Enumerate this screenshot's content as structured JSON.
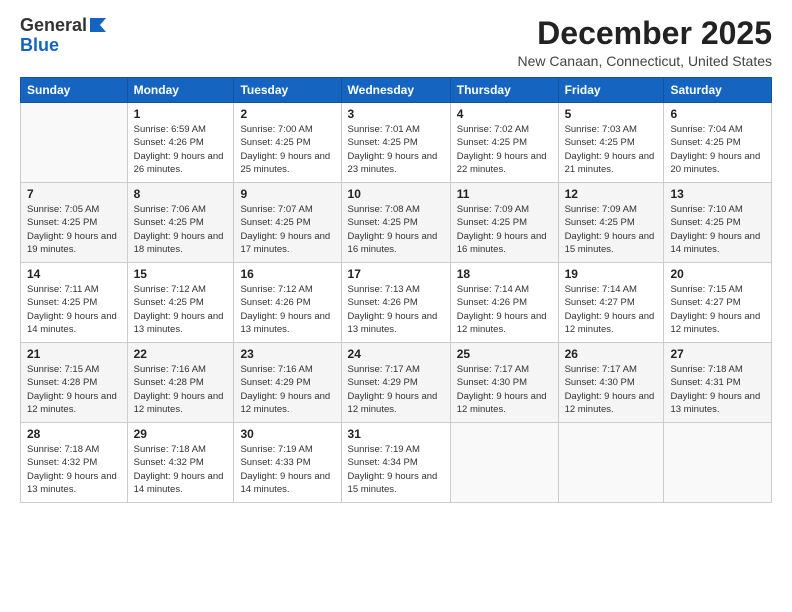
{
  "logo": {
    "general": "General",
    "blue": "Blue"
  },
  "header": {
    "month": "December 2025",
    "location": "New Canaan, Connecticut, United States"
  },
  "days_of_week": [
    "Sunday",
    "Monday",
    "Tuesday",
    "Wednesday",
    "Thursday",
    "Friday",
    "Saturday"
  ],
  "weeks": [
    [
      {
        "day": "",
        "sunrise": "",
        "sunset": "",
        "daylight": ""
      },
      {
        "day": "1",
        "sunrise": "Sunrise: 6:59 AM",
        "sunset": "Sunset: 4:26 PM",
        "daylight": "Daylight: 9 hours and 26 minutes."
      },
      {
        "day": "2",
        "sunrise": "Sunrise: 7:00 AM",
        "sunset": "Sunset: 4:25 PM",
        "daylight": "Daylight: 9 hours and 25 minutes."
      },
      {
        "day": "3",
        "sunrise": "Sunrise: 7:01 AM",
        "sunset": "Sunset: 4:25 PM",
        "daylight": "Daylight: 9 hours and 23 minutes."
      },
      {
        "day": "4",
        "sunrise": "Sunrise: 7:02 AM",
        "sunset": "Sunset: 4:25 PM",
        "daylight": "Daylight: 9 hours and 22 minutes."
      },
      {
        "day": "5",
        "sunrise": "Sunrise: 7:03 AM",
        "sunset": "Sunset: 4:25 PM",
        "daylight": "Daylight: 9 hours and 21 minutes."
      },
      {
        "day": "6",
        "sunrise": "Sunrise: 7:04 AM",
        "sunset": "Sunset: 4:25 PM",
        "daylight": "Daylight: 9 hours and 20 minutes."
      }
    ],
    [
      {
        "day": "7",
        "sunrise": "Sunrise: 7:05 AM",
        "sunset": "Sunset: 4:25 PM",
        "daylight": "Daylight: 9 hours and 19 minutes."
      },
      {
        "day": "8",
        "sunrise": "Sunrise: 7:06 AM",
        "sunset": "Sunset: 4:25 PM",
        "daylight": "Daylight: 9 hours and 18 minutes."
      },
      {
        "day": "9",
        "sunrise": "Sunrise: 7:07 AM",
        "sunset": "Sunset: 4:25 PM",
        "daylight": "Daylight: 9 hours and 17 minutes."
      },
      {
        "day": "10",
        "sunrise": "Sunrise: 7:08 AM",
        "sunset": "Sunset: 4:25 PM",
        "daylight": "Daylight: 9 hours and 16 minutes."
      },
      {
        "day": "11",
        "sunrise": "Sunrise: 7:09 AM",
        "sunset": "Sunset: 4:25 PM",
        "daylight": "Daylight: 9 hours and 16 minutes."
      },
      {
        "day": "12",
        "sunrise": "Sunrise: 7:09 AM",
        "sunset": "Sunset: 4:25 PM",
        "daylight": "Daylight: 9 hours and 15 minutes."
      },
      {
        "day": "13",
        "sunrise": "Sunrise: 7:10 AM",
        "sunset": "Sunset: 4:25 PM",
        "daylight": "Daylight: 9 hours and 14 minutes."
      }
    ],
    [
      {
        "day": "14",
        "sunrise": "Sunrise: 7:11 AM",
        "sunset": "Sunset: 4:25 PM",
        "daylight": "Daylight: 9 hours and 14 minutes."
      },
      {
        "day": "15",
        "sunrise": "Sunrise: 7:12 AM",
        "sunset": "Sunset: 4:25 PM",
        "daylight": "Daylight: 9 hours and 13 minutes."
      },
      {
        "day": "16",
        "sunrise": "Sunrise: 7:12 AM",
        "sunset": "Sunset: 4:26 PM",
        "daylight": "Daylight: 9 hours and 13 minutes."
      },
      {
        "day": "17",
        "sunrise": "Sunrise: 7:13 AM",
        "sunset": "Sunset: 4:26 PM",
        "daylight": "Daylight: 9 hours and 13 minutes."
      },
      {
        "day": "18",
        "sunrise": "Sunrise: 7:14 AM",
        "sunset": "Sunset: 4:26 PM",
        "daylight": "Daylight: 9 hours and 12 minutes."
      },
      {
        "day": "19",
        "sunrise": "Sunrise: 7:14 AM",
        "sunset": "Sunset: 4:27 PM",
        "daylight": "Daylight: 9 hours and 12 minutes."
      },
      {
        "day": "20",
        "sunrise": "Sunrise: 7:15 AM",
        "sunset": "Sunset: 4:27 PM",
        "daylight": "Daylight: 9 hours and 12 minutes."
      }
    ],
    [
      {
        "day": "21",
        "sunrise": "Sunrise: 7:15 AM",
        "sunset": "Sunset: 4:28 PM",
        "daylight": "Daylight: 9 hours and 12 minutes."
      },
      {
        "day": "22",
        "sunrise": "Sunrise: 7:16 AM",
        "sunset": "Sunset: 4:28 PM",
        "daylight": "Daylight: 9 hours and 12 minutes."
      },
      {
        "day": "23",
        "sunrise": "Sunrise: 7:16 AM",
        "sunset": "Sunset: 4:29 PM",
        "daylight": "Daylight: 9 hours and 12 minutes."
      },
      {
        "day": "24",
        "sunrise": "Sunrise: 7:17 AM",
        "sunset": "Sunset: 4:29 PM",
        "daylight": "Daylight: 9 hours and 12 minutes."
      },
      {
        "day": "25",
        "sunrise": "Sunrise: 7:17 AM",
        "sunset": "Sunset: 4:30 PM",
        "daylight": "Daylight: 9 hours and 12 minutes."
      },
      {
        "day": "26",
        "sunrise": "Sunrise: 7:17 AM",
        "sunset": "Sunset: 4:30 PM",
        "daylight": "Daylight: 9 hours and 12 minutes."
      },
      {
        "day": "27",
        "sunrise": "Sunrise: 7:18 AM",
        "sunset": "Sunset: 4:31 PM",
        "daylight": "Daylight: 9 hours and 13 minutes."
      }
    ],
    [
      {
        "day": "28",
        "sunrise": "Sunrise: 7:18 AM",
        "sunset": "Sunset: 4:32 PM",
        "daylight": "Daylight: 9 hours and 13 minutes."
      },
      {
        "day": "29",
        "sunrise": "Sunrise: 7:18 AM",
        "sunset": "Sunset: 4:32 PM",
        "daylight": "Daylight: 9 hours and 14 minutes."
      },
      {
        "day": "30",
        "sunrise": "Sunrise: 7:19 AM",
        "sunset": "Sunset: 4:33 PM",
        "daylight": "Daylight: 9 hours and 14 minutes."
      },
      {
        "day": "31",
        "sunrise": "Sunrise: 7:19 AM",
        "sunset": "Sunset: 4:34 PM",
        "daylight": "Daylight: 9 hours and 15 minutes."
      },
      {
        "day": "",
        "sunrise": "",
        "sunset": "",
        "daylight": ""
      },
      {
        "day": "",
        "sunrise": "",
        "sunset": "",
        "daylight": ""
      },
      {
        "day": "",
        "sunrise": "",
        "sunset": "",
        "daylight": ""
      }
    ]
  ]
}
